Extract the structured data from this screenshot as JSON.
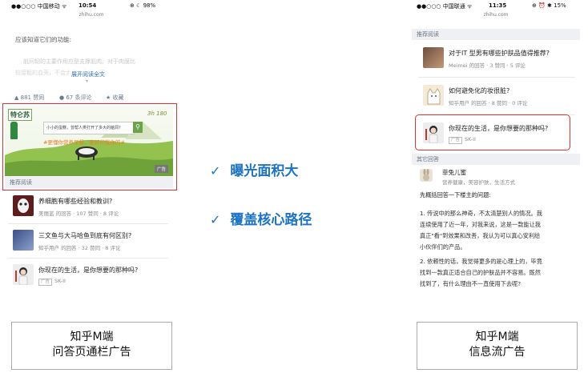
{
  "left_phone": {
    "status": {
      "carrier": "●●○○○ 中国移动 ᯤ",
      "time": "10:54",
      "battery": "⊕ ☾ 98%"
    },
    "url": "zhihu.com",
    "article_lead": "应该知道它们的功能:",
    "article_faded_1": "肌间韧的主要作用应是支撑肌肉。对于肉膜比",
    "article_faded_2": "较接粗的血壳，不会太皮，皮上，更",
    "expand_label": "展开阅读全文",
    "stats": {
      "likes": "881 赞同",
      "comments": "67 条评论",
      "favorite": "收藏"
    },
    "banner": {
      "brand": "特仑苏",
      "search_hint": "小小的蛋糕，曾帮人类打开了多大的脑洞?",
      "slogan": "#更懂你营养早餐，更好的我你的#",
      "badge": "3h 180",
      "corner_tag": "广告"
    },
    "recommend_header": "推荐阅读",
    "items": [
      {
        "title": "养细胞有哪些经验和教训?",
        "meta": "美丽蓝 的回答 · 107 赞同 · 8 评论"
      },
      {
        "title": "三文鱼与大马哈鱼到底有何区别?",
        "meta": "知乎用户 的回答 · 32 赞同 · 8 评论"
      },
      {
        "title": "你现在的生活，是你想要的那种吗?",
        "ad_tag": "广告",
        "meta": "SK-II"
      }
    ],
    "caption_line1": "知乎M端",
    "caption_line2": "问答页通栏广告"
  },
  "center": {
    "check_glyph": "✓",
    "point1": "曝光面积大",
    "point2": "覆盖核心路径"
  },
  "right_phone": {
    "status": {
      "carrier": "●●○○○ 中国联通 ᯤ",
      "time": "11:35",
      "battery": "⊕ ⏰ ✱ 15%"
    },
    "url": "zhihu.com",
    "recommend_header": "推荐阅读",
    "items": [
      {
        "title": "对于IT 型男有哪些护肤品值得推荐?",
        "meta": "Meimei 的回答 · 3 赞同 · 5 评论"
      },
      {
        "title": "如何避免化的妆很脏?",
        "meta": "知乎用户 的回答 · 8 赞同 · 0 评论"
      },
      {
        "title": "你现在的生活，是你想要的那种吗?",
        "ad_tag": "广告",
        "meta": "SK-II"
      }
    ],
    "other_header": "其它回答",
    "answer": {
      "author": "菲兔儿蜜",
      "bio": "营养健康，美容护肤，生活方式",
      "lead": "先概括回答一下楼主的问题:",
      "lines": [
        "1. 传说中的那么神奇，不太清楚别人的情况。我",
        "连续使用了近一年，对我来说，这是一款能让我",
        "真正\"看\"到效果和改善，我认为可以真心安利给",
        "小伙伴们的产品。",
        "2. 依赖性的话，我觉得更多的是心理上的，毕竟",
        "找到一款真正适合自己的护肤品并不容易。既然",
        "找到了，有什么理由不一直使用下去呢?"
      ]
    },
    "caption_line1": "知乎M端",
    "caption_line2": "信息流广告"
  },
  "colors": {
    "accent_blue": "#1b73c9",
    "highlight_red": "#e0312e",
    "zhihu_blue": "#1e88e5"
  }
}
